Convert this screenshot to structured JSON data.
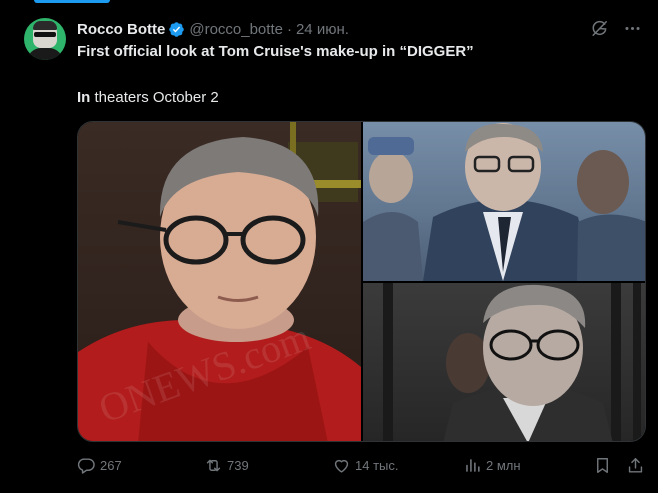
{
  "author": {
    "name": "Rocco Botte",
    "handle": "@rocco_botte",
    "separator": "·",
    "date": "24 июн."
  },
  "post": {
    "line1": "First official look at Tom Cruise's make-up in “DIGGER”",
    "line2_bold": "In",
    "line2_rest": " theaters October 2"
  },
  "media": {
    "watermark": "ONEWS.com"
  },
  "actions": {
    "replies": "267",
    "reposts": "739",
    "likes": "14 тыс.",
    "views": "2 млн"
  },
  "colors": {
    "accent": "#1d9bf0",
    "text": "#e7e9ea",
    "muted": "#71767b",
    "background": "#000000"
  },
  "icons": [
    "verified-badge-icon",
    "grok-icon",
    "more-icon",
    "reply-icon",
    "repost-icon",
    "like-icon",
    "views-icon",
    "bookmark-icon",
    "share-icon"
  ]
}
